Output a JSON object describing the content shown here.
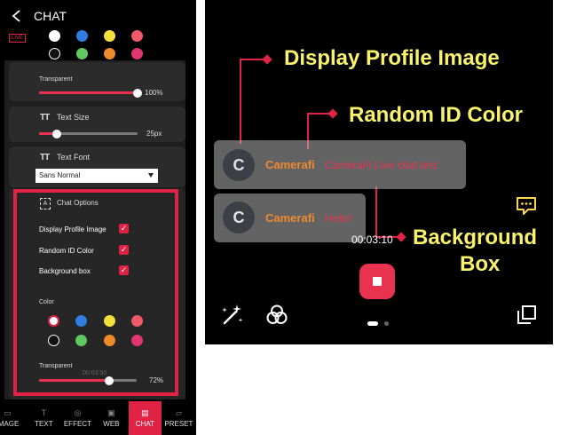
{
  "left_panel": {
    "title": "CHAT",
    "live_badge": "LIVE",
    "top_color_rows": [
      [
        "#ffffff",
        "#2f7de0",
        "#f5df3a",
        "#ee5a68"
      ],
      [
        "#111111",
        "#5fc95f",
        "#f08a2a",
        "#e0356e"
      ]
    ],
    "transparent_section": {
      "label": "Transparent",
      "value": "100%",
      "level": 1.0
    },
    "text_size": {
      "label": "Text Size",
      "value": "25px",
      "level": 0.18
    },
    "text_font": {
      "label": "Text Font",
      "selected": "Sans Normal"
    },
    "chat_options": {
      "label": "Chat Options",
      "items": [
        {
          "label": "Display Profile Image",
          "checked": true
        },
        {
          "label": "Random ID Color",
          "checked": true
        },
        {
          "label": "Background box",
          "checked": true
        }
      ]
    },
    "color_section": {
      "label": "Color",
      "rows": [
        [
          "#ffffff",
          "#2f7de0",
          "#f5df3a",
          "#ee5a68"
        ],
        [
          "#111111",
          "#5fc95f",
          "#f08a2a",
          "#e0356e"
        ]
      ]
    },
    "bottom_transparent": {
      "label": "Transparent",
      "value": "72%",
      "level": 0.72,
      "overlay_time": "00:03:50"
    },
    "tabs": [
      {
        "label": "IMAGE",
        "icon": "image-icon",
        "active": false
      },
      {
        "label": "TEXT",
        "icon": "text-icon",
        "active": false
      },
      {
        "label": "EFFECT",
        "icon": "effect-icon",
        "active": false
      },
      {
        "label": "WEB",
        "icon": "web-icon",
        "active": false
      },
      {
        "label": "CHAT",
        "icon": "chat-icon",
        "active": true
      },
      {
        "label": "PRESET",
        "icon": "preset-icon",
        "active": false
      }
    ],
    "highlight_color": "#e02245"
  },
  "right_panel": {
    "chat_messages": [
      {
        "avatar": "C",
        "name": "Camerafi",
        "message": "CameraFi Live chat test"
      },
      {
        "avatar": "C",
        "name": "Camerafi",
        "message": "Hello!"
      }
    ],
    "annotations": {
      "display_profile_image": "Display Profile Image",
      "random_id_color": "Random ID Color",
      "background_box_line1": "Background",
      "background_box_line2": "Box"
    },
    "timer": "00:03:10",
    "annotation_color": "#f8f36a",
    "accent": "#e8324f",
    "name_color": "#f08a30"
  }
}
